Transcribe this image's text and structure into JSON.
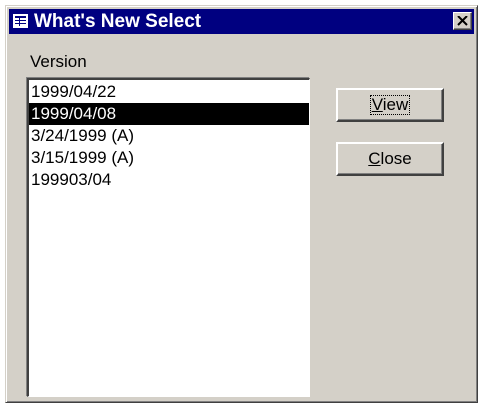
{
  "window": {
    "title": "What's New Select",
    "close_glyph": "✕"
  },
  "version_label": "Version",
  "versions": [
    {
      "label": "1999/04/22",
      "selected": false
    },
    {
      "label": "1999/04/08",
      "selected": true
    },
    {
      "label": "3/24/1999 (A)",
      "selected": false
    },
    {
      "label": "3/15/1999 (A)",
      "selected": false
    },
    {
      "label": "199903/04",
      "selected": false
    }
  ],
  "buttons": {
    "view": {
      "mnemonic": "V",
      "rest": "iew"
    },
    "close": {
      "mnemonic": "C",
      "rest": "lose"
    }
  },
  "colors": {
    "titlebar": "#000080",
    "face": "#d4d0c8",
    "selection": "#000000"
  }
}
